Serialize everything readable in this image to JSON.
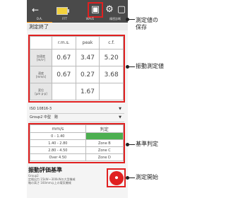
{
  "toolbar": {
    "back_icon": "back-arrow-icon",
    "tabs": [
      "O.A.",
      "FFT",
      "WAVE",
      "精密診断"
    ]
  },
  "status": "測定終了",
  "measurement": {
    "headers": [
      "",
      "r.m.s.",
      "peak",
      "c.f."
    ],
    "rows": [
      {
        "label": "加速度\n[m/s²]",
        "values": [
          "0.67",
          "3.47",
          "5.20"
        ]
      },
      {
        "label": "速度\n[mm/s]",
        "values": [
          "0.67",
          "0.27",
          "3.68"
        ]
      },
      {
        "label": "変位\n[µm p-p]",
        "values": [
          "",
          "1.67",
          ""
        ]
      }
    ]
  },
  "dropdowns": {
    "standard": "ISO 10816-3",
    "group": "Group2 中型　剛"
  },
  "judge": {
    "headers": [
      "mm/s",
      "判定"
    ],
    "rows": [
      {
        "range": "0 - 1.40",
        "zone": ""
      },
      {
        "range": "1.40 - 2.80",
        "zone": "Zone B"
      },
      {
        "range": "2.80 - 4.50",
        "zone": "Zone C"
      },
      {
        "range": "Over 4.50",
        "zone": "Zone D"
      }
    ]
  },
  "criteria": {
    "title": "振動評価基準",
    "desc1": "Group2",
    "desc2": "定格出力 15kW～300kWの大型機械",
    "desc3": "軸の高さ 160mm以上の電気機械"
  },
  "callouts": {
    "save": "測定値の\n保存",
    "values": "振動測定値",
    "judge": "基準判定",
    "start": "測定開始"
  },
  "colors": {
    "accent": "#e02020",
    "zone_highlight": "#4caf50",
    "toolbar": "#4a4a4a"
  }
}
